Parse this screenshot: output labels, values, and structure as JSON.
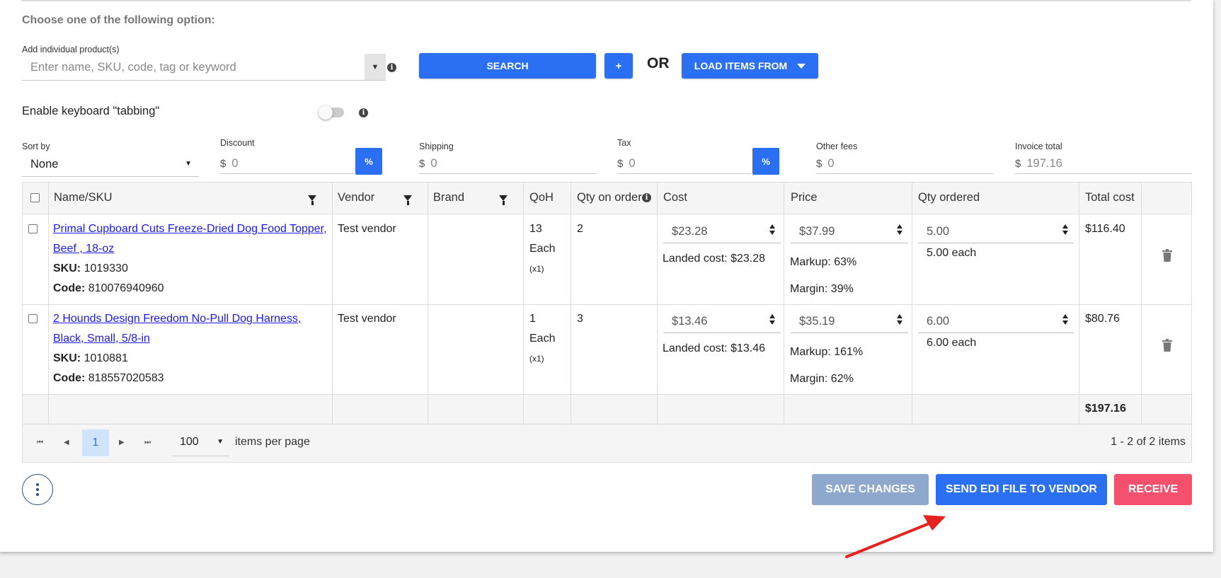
{
  "heading": "Choose one of the following option:",
  "add_product": {
    "label": "Add individual product(s)",
    "placeholder": "Enter name, SKU, code, tag or keyword"
  },
  "buttons": {
    "search": "SEARCH",
    "plus": "+",
    "or": "OR",
    "load_items": "LOAD ITEMS FROM"
  },
  "keyboard_tabbing": {
    "label": "Enable keyboard \"tabbing\"",
    "enabled": false
  },
  "fields": {
    "sort_by": {
      "label": "Sort by",
      "value": "None"
    },
    "discount": {
      "label": "Discount",
      "currency": "$",
      "value": "0",
      "pct": "%"
    },
    "shipping": {
      "label": "Shipping",
      "currency": "$",
      "value": "0"
    },
    "tax": {
      "label": "Tax",
      "currency": "$",
      "value": "0",
      "pct": "%"
    },
    "other_fees": {
      "label": "Other fees",
      "currency": "$",
      "value": "0"
    },
    "invoice_total": {
      "label": "Invoice total",
      "currency": "$",
      "value": "197.16"
    }
  },
  "table": {
    "headers": {
      "name": "Name/SKU",
      "vendor": "Vendor",
      "brand": "Brand",
      "qoh": "QoH",
      "qty_on_order": "Qty on order",
      "cost": "Cost",
      "price": "Price",
      "qty_ordered": "Qty ordered",
      "total_cost": "Total cost"
    },
    "rows": [
      {
        "name_line1": "Primal Cupboard Cuts Freeze-Dried Dog Food Topper,",
        "name_line2": "Beef , 18-oz",
        "sku_label": "SKU:",
        "sku": "1019330",
        "code_label": "Code:",
        "code": "810076940960",
        "vendor": "Test vendor",
        "brand": "",
        "qoh": "13",
        "qoh_unit": "Each",
        "qoh_mult": "(x1)",
        "qty_on_order": "2",
        "cost": "$23.28",
        "landed_cost": "Landed cost: $23.28",
        "price": "$37.99",
        "markup": "Markup: 63%",
        "margin": "Margin: 39%",
        "qty_ordered": "5.00",
        "qty_each": "5.00 each",
        "total_cost": "$116.40"
      },
      {
        "name_line1": "2 Hounds Design Freedom No-Pull Dog Harness,",
        "name_line2": "Black, Small, 5/8-in",
        "sku_label": "SKU:",
        "sku": "1010881",
        "code_label": "Code:",
        "code": "818557020583",
        "vendor": "Test vendor",
        "brand": "",
        "qoh": "1",
        "qoh_unit": "Each",
        "qoh_mult": "(x1)",
        "qty_on_order": "3",
        "cost": "$13.46",
        "landed_cost": "Landed cost: $13.46",
        "price": "$35.19",
        "markup": "Markup: 161%",
        "margin": "Margin: 62%",
        "qty_ordered": "6.00",
        "qty_each": "6.00 each",
        "total_cost": "$80.76"
      }
    ],
    "footer_total": "$197.16"
  },
  "pager": {
    "current_page": "1",
    "per_page": "100",
    "per_page_label": "items per page",
    "summary": "1 - 2 of 2 items"
  },
  "actions": {
    "save": "SAVE CHANGES",
    "send_edi": "SEND EDI FILE TO VENDOR",
    "receive": "RECEIVE"
  },
  "colors": {
    "primary": "#2b6ff2",
    "save_disabled": "#8ea7cc",
    "receive": "#f5506e",
    "annotation_arrow": "#e8231f"
  }
}
